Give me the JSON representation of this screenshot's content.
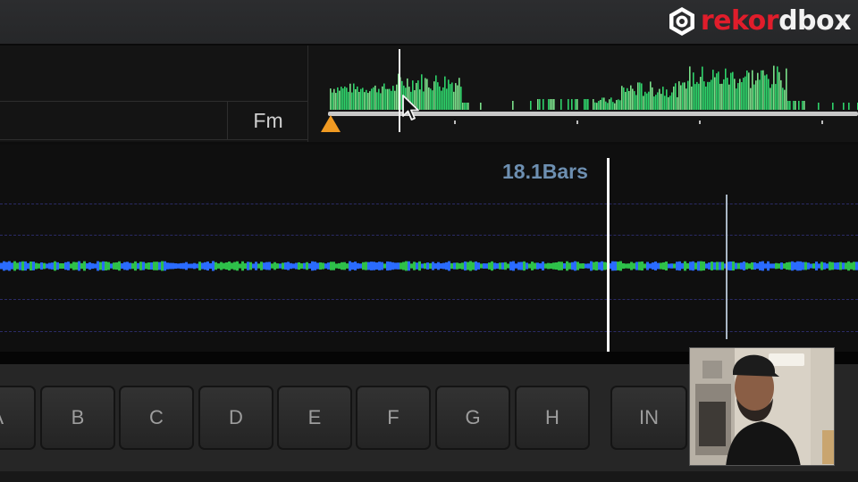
{
  "brand": {
    "name": "rekordbox",
    "name_red": "rekor",
    "name_white": "dbox",
    "accent": "#e01d2b"
  },
  "track": {
    "key": "Fm"
  },
  "overview": {
    "playhead_fraction": 0.16,
    "cue_color": "#f09a22"
  },
  "waveform": {
    "bars_label": "18.1Bars",
    "wave_colors": [
      "#2a6bff",
      "#2ec04a"
    ]
  },
  "hot_cues": [
    "A",
    "B",
    "C",
    "D",
    "E",
    "F",
    "G",
    "H"
  ],
  "in_button": "IN",
  "icons": {
    "logo": "rekordbox-logo-icon",
    "cursor": "mouse-pointer-icon",
    "cue": "memory-cue-triangle-icon"
  }
}
